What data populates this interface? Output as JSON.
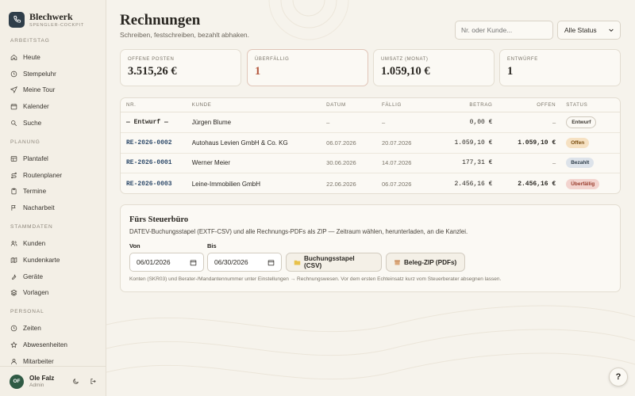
{
  "brand": {
    "name": "Blechwerk",
    "sub": "SPENGLER-COCKPIT"
  },
  "sidebar": {
    "sections": [
      {
        "title": "ARBEITSTAG",
        "items": [
          {
            "label": "Heute",
            "icon": "home-icon"
          },
          {
            "label": "Stempeluhr",
            "icon": "clock-icon"
          },
          {
            "label": "Meine Tour",
            "icon": "send-icon"
          },
          {
            "label": "Kalender",
            "icon": "calendar-icon"
          },
          {
            "label": "Suche",
            "icon": "search-icon"
          }
        ]
      },
      {
        "title": "PLANUNG",
        "items": [
          {
            "label": "Plantafel",
            "icon": "board-icon"
          },
          {
            "label": "Routenplaner",
            "icon": "route-icon"
          },
          {
            "label": "Termine",
            "icon": "clipboard-icon"
          },
          {
            "label": "Nacharbeit",
            "icon": "flag-icon"
          }
        ]
      },
      {
        "title": "STAMMDATEN",
        "items": [
          {
            "label": "Kunden",
            "icon": "users-icon"
          },
          {
            "label": "Kundenkarte",
            "icon": "map-icon"
          },
          {
            "label": "Geräte",
            "icon": "wrench-icon"
          },
          {
            "label": "Vorlagen",
            "icon": "layers-icon"
          }
        ]
      },
      {
        "title": "PERSONAL",
        "items": [
          {
            "label": "Zeiten",
            "icon": "clock-icon"
          },
          {
            "label": "Abwesenheiten",
            "icon": "star-icon"
          },
          {
            "label": "Mitarbeiter",
            "icon": "user-icon"
          }
        ]
      }
    ]
  },
  "user": {
    "initials": "OF",
    "name": "Ole Falz",
    "role": "Admin"
  },
  "header": {
    "title": "Rechnungen",
    "subtitle": "Schreiben, festschreiben, bezahlt abhaken.",
    "search_placeholder": "Nr. oder Kunde...",
    "status_filter": "Alle Status"
  },
  "stats": [
    {
      "label": "OFFENE POSTEN",
      "value": "3.515,26 €"
    },
    {
      "label": "ÜBERFÄLLIG",
      "value": "1"
    },
    {
      "label": "UMSATZ (MONAT)",
      "value": "1.059,10 €"
    },
    {
      "label": "ENTWÜRFE",
      "value": "1"
    }
  ],
  "table": {
    "columns": [
      "NR.",
      "KUNDE",
      "DATUM",
      "FÄLLIG",
      "BETRAG",
      "OFFEN",
      "STATUS"
    ],
    "rows": [
      {
        "nr": "— Entwurf —",
        "kunde": "Jürgen Blume",
        "datum": "–",
        "faellig": "–",
        "betrag": "0,00 €",
        "offen": "–",
        "status": "Entwurf"
      },
      {
        "nr": "RE-2026-0002",
        "kunde": "Autohaus Levien GmbH & Co. KG",
        "datum": "06.07.2026",
        "faellig": "20.07.2026",
        "betrag": "1.059,10 €",
        "offen": "1.059,10 €",
        "status": "Offen"
      },
      {
        "nr": "RE-2026-0001",
        "kunde": "Werner Meier",
        "datum": "30.06.2026",
        "faellig": "14.07.2026",
        "betrag": "177,31 €",
        "offen": "–",
        "status": "Bezahlt"
      },
      {
        "nr": "RE-2026-0003",
        "kunde": "Leine-Immobilien GmbH",
        "datum": "22.06.2026",
        "faellig": "06.07.2026",
        "betrag": "2.456,16 €",
        "offen": "2.456,16 €",
        "status": "Überfällig"
      }
    ]
  },
  "tax": {
    "title": "Fürs Steuerbüro",
    "desc": "DATEV-Buchungsstapel (EXTF-CSV) und alle Rechnungs-PDFs als ZIP — Zeitraum wählen, herunterladen, an die Kanzlei.",
    "from_label": "Von",
    "from_value": "06/01/2026",
    "to_label": "Bis",
    "to_value": "06/30/2026",
    "csv_button": "Buchungsstapel (CSV)",
    "zip_button": "Beleg-ZIP (PDFs)",
    "note": "Konten (SKR03) und Berater-/Mandantennummer unter Einstellungen → Rechnungswesen. Vor dem ersten Echteinsatz kurz vom Steuerberater absegnen lassen."
  },
  "help": "?"
}
